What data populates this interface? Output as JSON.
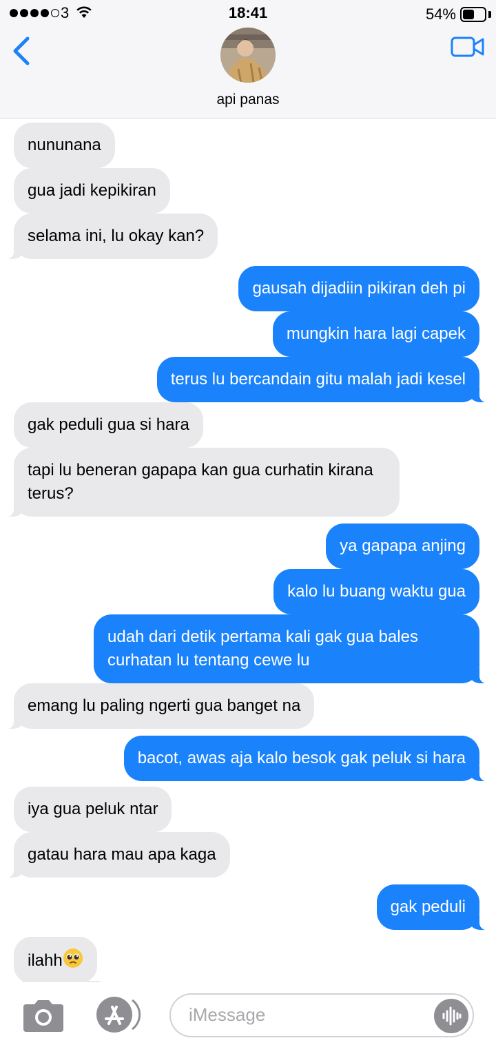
{
  "status_bar": {
    "carrier": "3",
    "time": "18:41",
    "battery_percent": "54%",
    "battery_level": 0.54
  },
  "header": {
    "contact_name": "api panas",
    "back_icon": "chevron-left-icon",
    "video_icon": "video-camera-icon"
  },
  "colors": {
    "incoming_bubble": "#e9e9eb",
    "outgoing_bubble": "#1a82fb",
    "accent": "#1a82fb"
  },
  "messages": [
    {
      "direction": "in",
      "text": "nununana"
    },
    {
      "direction": "in",
      "text": "gua jadi kepikiran"
    },
    {
      "direction": "in",
      "text": "selama ini, lu okay kan?"
    },
    {
      "direction": "out",
      "text": "gausah dijadiin pikiran deh pi"
    },
    {
      "direction": "out",
      "text": "mungkin hara lagi capek"
    },
    {
      "direction": "out",
      "text": "terus lu bercandain gitu malah jadi kesel"
    },
    {
      "direction": "in",
      "text": "gak peduli gua si hara"
    },
    {
      "direction": "in",
      "text": "tapi lu beneran gapapa kan gua curhatin kirana terus?"
    },
    {
      "direction": "out",
      "text": "ya gapapa anjing"
    },
    {
      "direction": "out",
      "text": "kalo lu buang waktu gua"
    },
    {
      "direction": "out",
      "text": "udah dari detik pertama kali gak gua bales curhatan lu tentang cewe lu"
    },
    {
      "direction": "in",
      "text": "emang lu paling ngerti gua banget na"
    },
    {
      "direction": "out",
      "text": "bacot, awas aja kalo besok gak peluk si hara"
    },
    {
      "direction": "in",
      "text": "iya gua peluk ntar"
    },
    {
      "direction": "in",
      "text": "gatau hara mau apa kaga"
    },
    {
      "direction": "out",
      "text": "gak peduli"
    },
    {
      "direction": "in",
      "text": "ilahh",
      "emoji": "pleading-face-emoji"
    }
  ],
  "composer": {
    "placeholder": "iMessage",
    "camera_icon": "camera-icon",
    "apps_icon": "app-store-icon",
    "audio_icon": "audio-waveform-icon"
  }
}
